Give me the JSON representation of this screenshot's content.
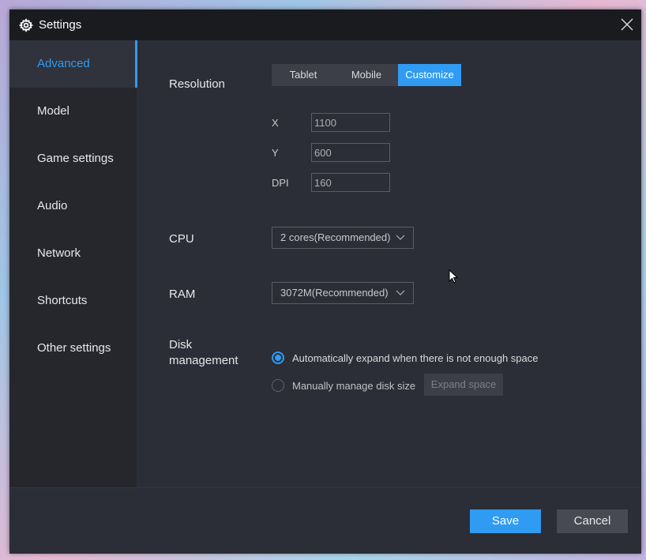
{
  "window": {
    "title": "Settings",
    "title_icon": "gear-icon",
    "close_icon": "close-icon"
  },
  "sidebar": {
    "active": "Advanced",
    "items": [
      {
        "label": "Advanced"
      },
      {
        "label": "Model"
      },
      {
        "label": "Game settings"
      },
      {
        "label": "Audio"
      },
      {
        "label": "Network"
      },
      {
        "label": "Shortcuts"
      },
      {
        "label": "Other settings"
      }
    ]
  },
  "resolution": {
    "label": "Resolution",
    "options": [
      "Tablet",
      "Mobile",
      "Customize"
    ],
    "selected": "Customize",
    "x_label": "X",
    "x_value": "1100",
    "y_label": "Y",
    "y_value": "600",
    "dpi_label": "DPI",
    "dpi_value": "160"
  },
  "cpu": {
    "label": "CPU",
    "value": "2 cores(Recommended)"
  },
  "ram": {
    "label": "RAM",
    "value": "3072M(Recommended)"
  },
  "disk": {
    "label_line1": "Disk",
    "label_line2": "management",
    "option_auto": "Automatically expand when there is not enough space",
    "option_manual": "Manually manage disk size",
    "selected": "auto",
    "expand_button": "Expand space"
  },
  "footer": {
    "save_label": "Save",
    "cancel_label": "Cancel"
  },
  "colors": {
    "accent": "#2f9bf3",
    "background": "#2b2e36",
    "titlebar": "#1a1b1f",
    "sidebar": "#25272d"
  }
}
